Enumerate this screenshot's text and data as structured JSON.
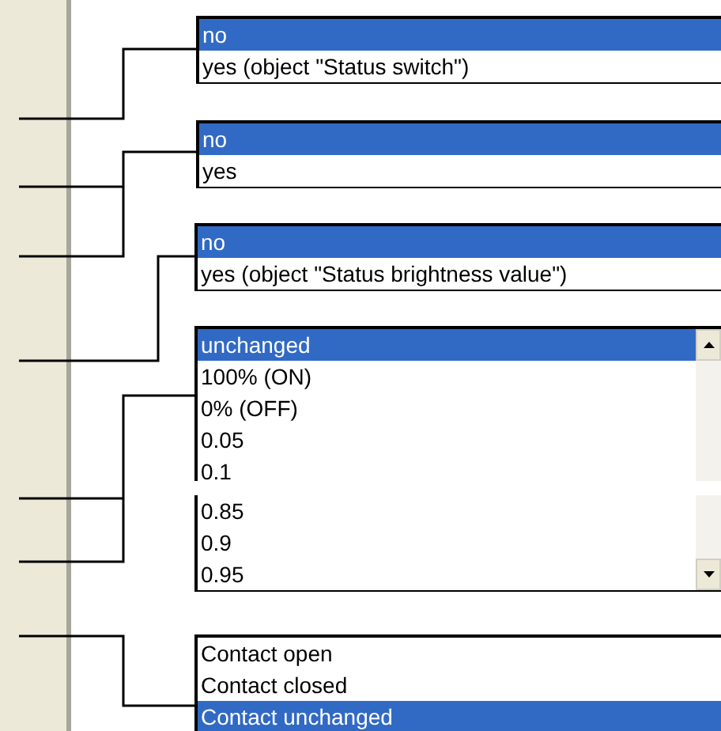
{
  "lists": [
    {
      "kind": "plain",
      "sections": [
        [
          {
            "label": "no",
            "selected": true
          },
          {
            "label": "yes (object \"Status switch\")",
            "selected": false
          }
        ]
      ]
    },
    {
      "kind": "plain",
      "sections": [
        [
          {
            "label": "no",
            "selected": true
          },
          {
            "label": "yes",
            "selected": false
          }
        ]
      ]
    },
    {
      "kind": "plain",
      "sections": [
        [
          {
            "label": "no",
            "selected": true
          },
          {
            "label": "yes (object \"Status brightness value\")",
            "selected": false
          }
        ]
      ]
    },
    {
      "kind": "scroll",
      "sections": [
        [
          {
            "label": "unchanged",
            "selected": true
          },
          {
            "label": "100% (ON)",
            "selected": false
          },
          {
            "label": "0% (OFF)",
            "selected": false
          },
          {
            "label": "0.05",
            "selected": false
          },
          {
            "label": "0.1",
            "selected": false
          }
        ],
        [
          {
            "label": "0.85",
            "selected": false
          },
          {
            "label": "0.9",
            "selected": false
          },
          {
            "label": "0.95",
            "selected": false
          }
        ]
      ]
    },
    {
      "kind": "plain",
      "sections": [
        [
          {
            "label": "Contact open",
            "selected": false
          },
          {
            "label": "Contact closed",
            "selected": false
          },
          {
            "label": "Contact unchanged",
            "selected": true
          }
        ]
      ]
    }
  ]
}
